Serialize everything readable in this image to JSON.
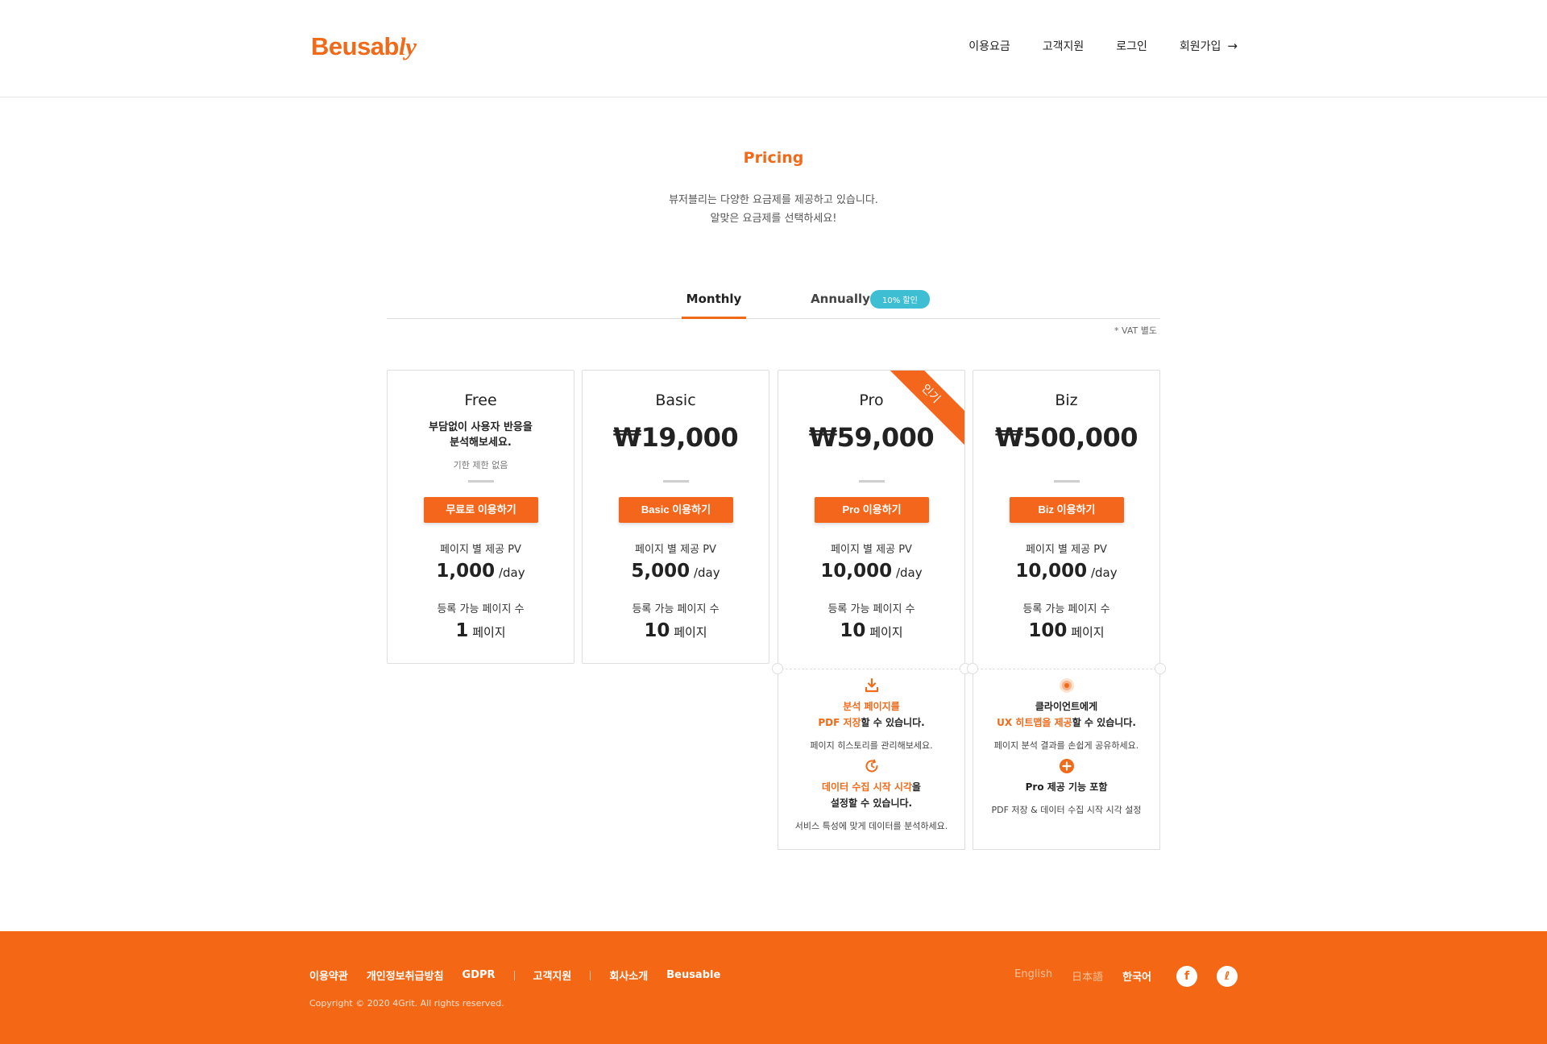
{
  "header": {
    "logo_main": "Beusab",
    "logo_italic": "ly",
    "nav": [
      "이용요금",
      "고객지원",
      "로그인",
      "회원가입"
    ],
    "signup_arrow": "→"
  },
  "hero": {
    "title": "Pricing",
    "line1": "뷰저블리는 다양한 요금제를 제공하고 있습니다.",
    "line2": "알맞은 요금제를 선택하세요!"
  },
  "tabs": {
    "monthly": "Monthly",
    "annually": "Annually",
    "discount": "10% 할인",
    "active": "Monthly"
  },
  "vat_note": "* VAT 별도",
  "plans": [
    {
      "name": "Free",
      "desc_line1": "부담없이 사용자 반응을",
      "desc_line2": "분석해보세요.",
      "note": "기한 제한 없음",
      "cta": "무료로 이용하기",
      "pv_label": "페이지 별 제공 PV",
      "pv_value": "1,000",
      "pv_unit": "/day",
      "pages_label": "등록 가능 페이지 수",
      "pages_value": "1",
      "pages_unit": "페이지"
    },
    {
      "name": "Basic",
      "price": "₩19,000",
      "cta": "Basic 이용하기",
      "pv_label": "페이지 별 제공 PV",
      "pv_value": "5,000",
      "pv_unit": "/day",
      "pages_label": "등록 가능 페이지 수",
      "pages_value": "10",
      "pages_unit": "페이지"
    },
    {
      "name": "Pro",
      "price": "₩59,000",
      "ribbon": "인기",
      "cta": "Pro 이용하기",
      "pv_label": "페이지 별 제공 PV",
      "pv_value": "10,000",
      "pv_unit": "/day",
      "pages_label": "등록 가능 페이지 수",
      "pages_value": "10",
      "pages_unit": "페이지"
    },
    {
      "name": "Biz",
      "price": "₩500,000",
      "cta": "Biz 이용하기",
      "pv_label": "페이지 별 제공 PV",
      "pv_value": "10,000",
      "pv_unit": "/day",
      "pages_label": "등록 가능 페이지 수",
      "pages_value": "100",
      "pages_unit": "페이지"
    }
  ],
  "pro_features": [
    {
      "icon": "download-icon",
      "hl1": "분석 페이지를",
      "hl2": "PDF 저장",
      "rest": "할 수 있습니다.",
      "desc": "페이지 히스토리를 관리해보세요."
    },
    {
      "icon": "clock-icon",
      "hl1": "데이터 수집 시작 시각",
      "rest1": "을",
      "line2": "설정할 수 있습니다.",
      "desc": "서비스 특성에 맞게 데이터를 분석하세요."
    }
  ],
  "biz_features": [
    {
      "icon": "heatmap-icon",
      "line1": "클라이언트에게",
      "hl": "UX 히트맵을 제공",
      "rest": "할 수 있습니다.",
      "desc": "페이지 분석 결과를 손쉽게 공유하세요."
    },
    {
      "icon": "plus-circle-icon",
      "title": "Pro 제공 기능 포함",
      "desc": "PDF 저장 & 데이터 수집 시작 시각 설정"
    }
  ],
  "footer": {
    "links_group1": [
      "이용약관",
      "개인정보취급방침",
      "GDPR"
    ],
    "links_group2": [
      "고객지원"
    ],
    "links_group3": [
      "회사소개",
      "Beusable"
    ],
    "copyright": "Copyright © 2020 4Grit. All rights reserved.",
    "languages": [
      "English",
      "日本語",
      "한국어"
    ],
    "active_language": "한국어",
    "social_facebook": "f",
    "social_beusably": "ℓ"
  },
  "colors": {
    "accent": "#f16a1a",
    "button": "#f4661b",
    "footer": "#f46815",
    "badge": "#3dbed3"
  }
}
